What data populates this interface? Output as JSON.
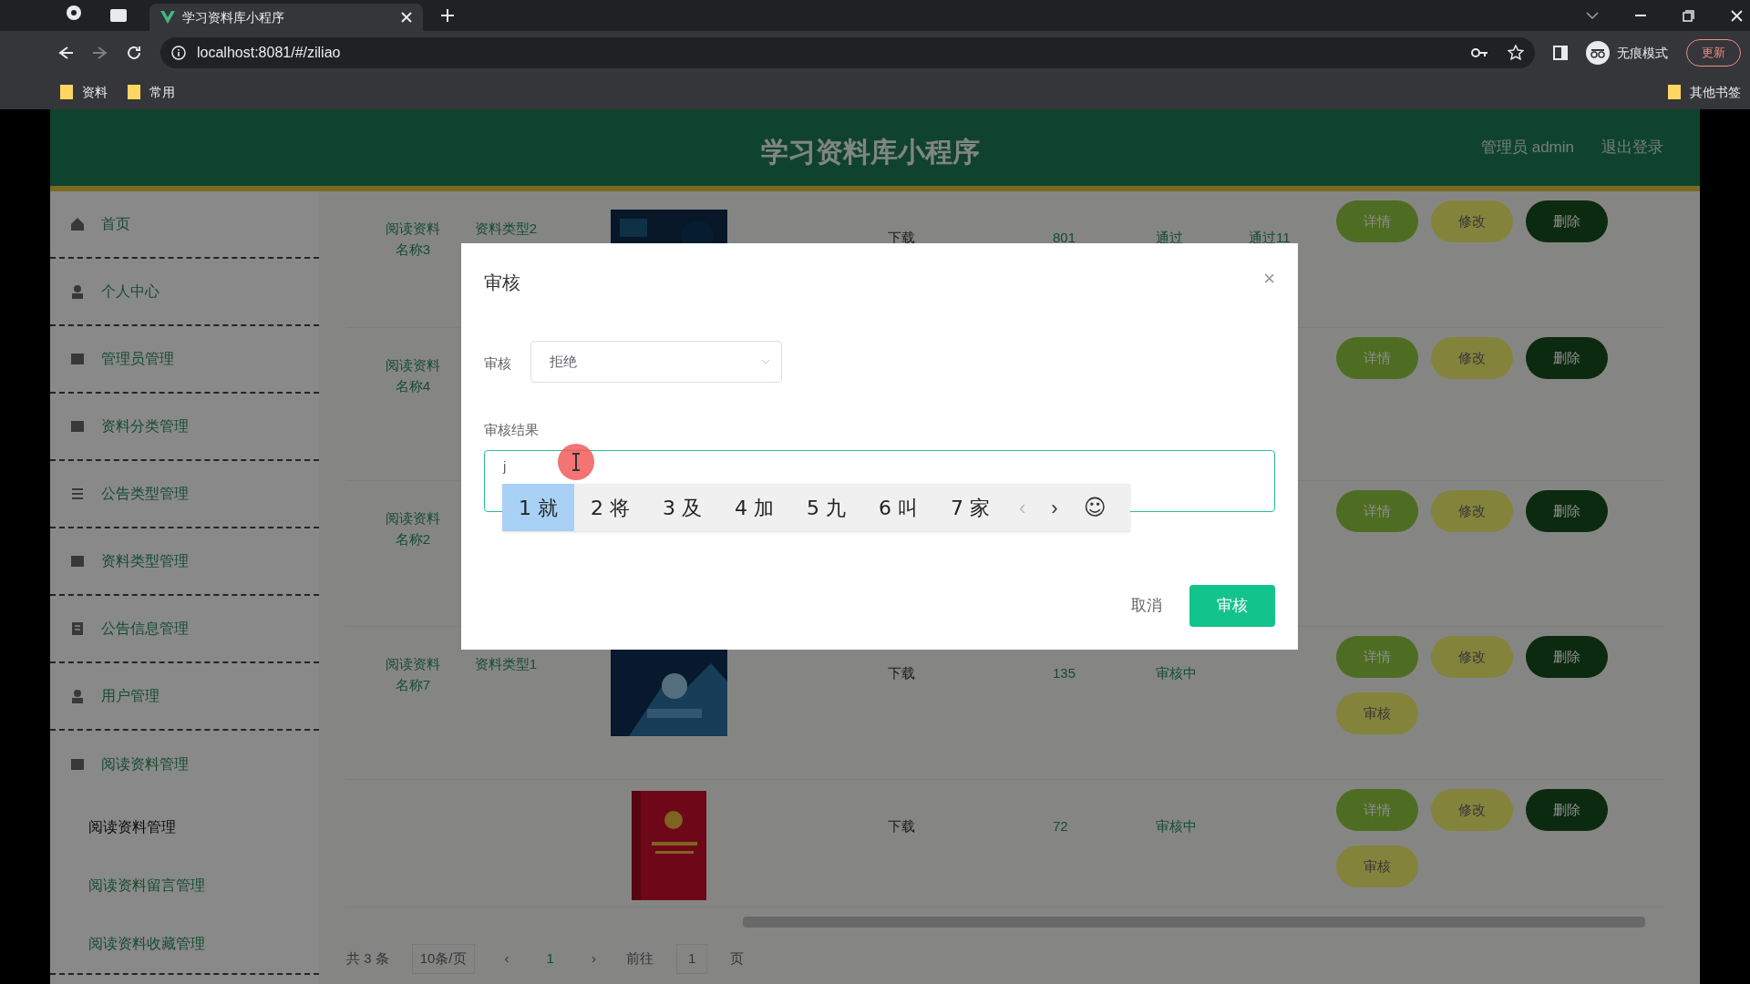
{
  "browser": {
    "tabs": [
      {
        "title": "学习资料库小程序",
        "selected": true
      }
    ],
    "address": "localhost:8081/#/ziliao",
    "bookmarks": [
      "资料",
      "常用"
    ],
    "other_bookmarks": "其他书签",
    "profile": "无痕模式",
    "update": "更新"
  },
  "header": {
    "title": "学习资料库小程序",
    "user": "管理员 admin",
    "logout": "退出登录"
  },
  "sidebar": {
    "items": [
      {
        "label": "首页",
        "kind": "home",
        "selected": false
      },
      {
        "label": "个人中心",
        "kind": "user",
        "selected": false
      },
      {
        "label": "管理员管理",
        "kind": "grid",
        "selected": false
      },
      {
        "label": "资料分类管理",
        "kind": "grid",
        "selected": false
      },
      {
        "label": "公告类型管理",
        "kind": "list",
        "selected": false
      },
      {
        "label": "资料类型管理",
        "kind": "grid",
        "selected": false
      },
      {
        "label": "公告信息管理",
        "kind": "doc",
        "selected": false
      },
      {
        "label": "用户管理",
        "kind": "user",
        "selected": false
      },
      {
        "label": "阅读资料管理",
        "kind": "grid",
        "selected": false,
        "children": [
          {
            "label": "阅读资料管理",
            "selected": true
          },
          {
            "label": "阅读资料留言管理",
            "selected": false
          },
          {
            "label": "阅读资料收藏管理",
            "selected": false
          }
        ]
      }
    ]
  },
  "table": {
    "rows": [
      {
        "name": "阅读资料名称3",
        "type": "资料类型2",
        "kind": "dark",
        "cells": [
          "下载",
          "801",
          "通过",
          "通过11"
        ],
        "buttons": [
          "详情",
          "修改",
          "删除"
        ]
      },
      {
        "name": "阅读资料名称4",
        "type": "",
        "kind": "none",
        "cells": [],
        "buttons": [
          "详情",
          "修改",
          "删除"
        ]
      },
      {
        "name": "阅读资料名称2",
        "type": "",
        "kind": "none",
        "cells": [],
        "buttons": [
          "详情",
          "修改",
          "删除"
        ]
      },
      {
        "name": "阅读资料名称7",
        "type": "资料类型1",
        "kind": "hand",
        "cells": [
          "下载",
          "135",
          "审核中"
        ],
        "buttons": [
          "详情",
          "修改",
          "删除",
          "审核"
        ]
      },
      {
        "name": "",
        "type": "",
        "kind": "book",
        "cells": [
          "下载",
          "72",
          "审核中"
        ],
        "buttons": [
          "详情",
          "修改",
          "删除",
          "审核"
        ]
      }
    ],
    "pagination": {
      "total": "共 3 条",
      "page_size": "10条/页",
      "prev": "‹",
      "page": "1",
      "next": "›",
      "goto": "前往",
      "goto_value": "1",
      "goto_unit": "页"
    }
  },
  "modal": {
    "title": "审核",
    "close": "×",
    "select": {
      "label": "审核",
      "value": "拒绝"
    },
    "textarea": {
      "label": "审核结果",
      "value": "j"
    },
    "ime": {
      "candidates": [
        {
          "label": "1 就",
          "selected": true
        },
        {
          "label": "2 将",
          "selected": false
        },
        {
          "label": "3 及",
          "selected": false
        },
        {
          "label": "4 加",
          "selected": false
        },
        {
          "label": "5 九",
          "selected": false
        },
        {
          "label": "6 叫",
          "selected": false
        },
        {
          "label": "7 家",
          "selected": false
        }
      ],
      "prev": "‹",
      "next": "›",
      "emoji": "☺"
    },
    "buttons": [
      {
        "label": "取消",
        "kind": "cancel"
      },
      {
        "label": "审核",
        "kind": "primary"
      }
    ]
  }
}
